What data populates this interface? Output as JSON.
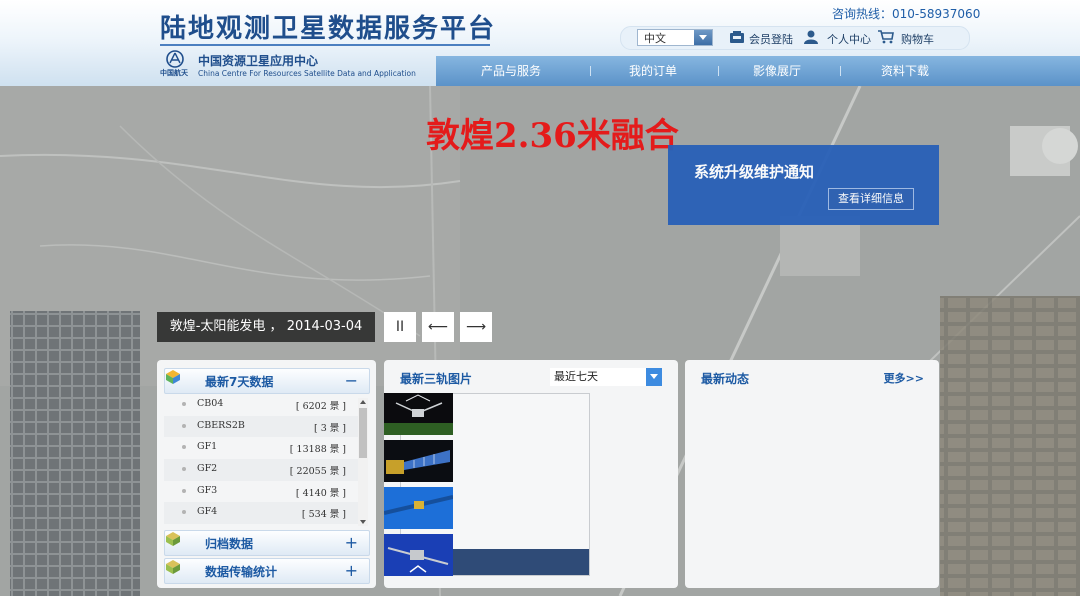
{
  "header": {
    "site_title": "陆地观测卫星数据服务平台",
    "org_logo_text": "中国航天",
    "org_name_cn": "中国资源卫星应用中心",
    "org_name_en": "China Centre For Resources Satellite Data and Application",
    "hotline_label": "咨询热线：",
    "hotline_number": "010-58937060",
    "language": "中文",
    "member_login": "会员登陆",
    "user_center": "个人中心",
    "cart": "购物车"
  },
  "nav": {
    "items": [
      {
        "label": "产品与服务"
      },
      {
        "label": "我的订单"
      },
      {
        "label": "影像展厅"
      },
      {
        "label": "资料下载"
      }
    ]
  },
  "banner": {
    "title": "敦煌2.36米融合",
    "caption": "敦煌-太阳能发电 ， 2014-03-04",
    "pause_symbol": "II",
    "prev_symbol": "⟵",
    "next_symbol": "⟶"
  },
  "notice": {
    "title": "系统升级维护通知",
    "button": "查看详细信息"
  },
  "latest_data": {
    "title": "最新7天数据",
    "toggle": "−",
    "items": [
      {
        "name": "CB04",
        "count": "[ 6202 景 ]"
      },
      {
        "name": "CBERS2B",
        "count": "[ 3 景 ]"
      },
      {
        "name": "GF1",
        "count": "[ 13188 景 ]"
      },
      {
        "name": "GF2",
        "count": "[ 22055 景 ]"
      },
      {
        "name": "GF3",
        "count": "[ 4140 景 ]"
      },
      {
        "name": "GF4",
        "count": "[ 534 景 ]"
      }
    ],
    "archive": {
      "title": "归档数据",
      "toggle": "+"
    },
    "transfer": {
      "title": "数据传输统计",
      "toggle": "+"
    }
  },
  "orbit_images": {
    "title": "最新三轨图片",
    "period": "最近七天"
  },
  "news": {
    "title": "最新动态",
    "more": "更多>>"
  },
  "colors": {
    "brand_blue": "#1d5aa3",
    "nav_blue": "#5b92c8",
    "notice_blue": "#2860b8",
    "title_red": "#e41b1b"
  }
}
